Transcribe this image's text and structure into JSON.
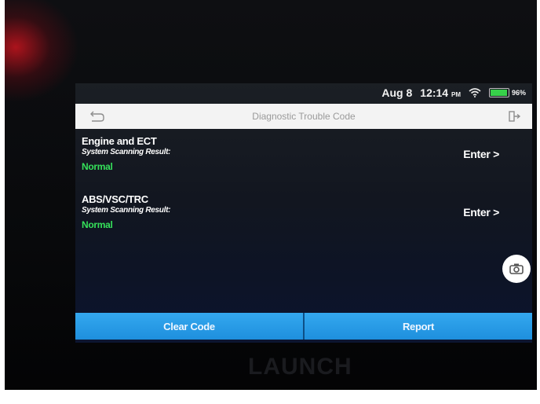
{
  "status_bar": {
    "date": "Aug 8",
    "time": "12:14",
    "meridiem": "PM",
    "battery_percent": "96%",
    "battery_level": 0.96
  },
  "header": {
    "title": "Diagnostic Trouble Code",
    "back_icon": "back-arrow-icon",
    "exit_icon": "exit-icon"
  },
  "systems": [
    {
      "name": "Engine and ECT",
      "result_label": "System Scanning Result:",
      "status": "Normal",
      "action": "Enter >"
    },
    {
      "name": "ABS/VSC/TRC",
      "result_label": "System Scanning Result:",
      "status": "Normal",
      "action": "Enter >"
    }
  ],
  "camera_icon": "camera-icon",
  "actions": {
    "clear": "Clear Code",
    "report": "Report"
  },
  "device_brand": "LAUNCH",
  "colors": {
    "accent": "#2b9de8",
    "status_ok": "#35e05a",
    "title_bg": "#f3f3f3"
  }
}
